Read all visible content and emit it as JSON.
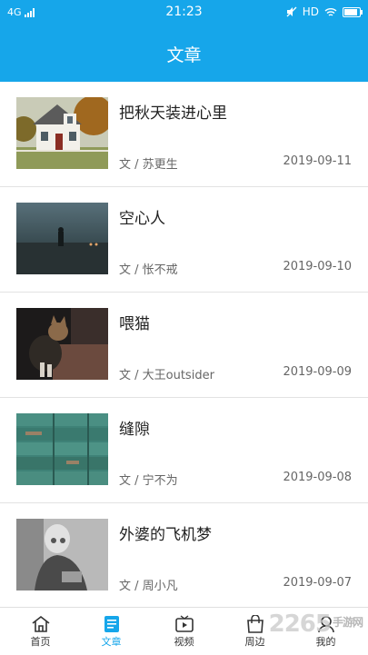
{
  "status_bar": {
    "network": "4G",
    "time": "21:23",
    "hd": "HD"
  },
  "header": {
    "title": "文章"
  },
  "articles": [
    {
      "title": "把秋天装进心里",
      "author": "文 / 苏更生",
      "date": "2019-09-11",
      "thumb": "house-photo"
    },
    {
      "title": "空心人",
      "author": "文 / 怅不戒",
      "date": "2019-09-10",
      "thumb": "dusk-field-photo"
    },
    {
      "title": "喂猫",
      "author": "文 / 大王outsider",
      "date": "2019-09-09",
      "thumb": "cat-photo"
    },
    {
      "title": "缝隙",
      "author": "文 / 宁不为",
      "date": "2019-09-08",
      "thumb": "wood-planks-photo"
    },
    {
      "title": "外婆的飞机梦",
      "author": "文 / 周小凡",
      "date": "2019-09-07",
      "thumb": "grandma-photo"
    }
  ],
  "tabs": [
    {
      "label": "首页",
      "icon": "home-icon"
    },
    {
      "label": "文章",
      "icon": "article-icon",
      "active": true
    },
    {
      "label": "视频",
      "icon": "video-icon"
    },
    {
      "label": "周边",
      "icon": "shop-bag-icon"
    },
    {
      "label": "我的",
      "icon": "user-icon"
    }
  ],
  "watermark": {
    "main": "2265",
    "sub": "手游网"
  },
  "colors": {
    "accent": "#16a6ea",
    "text": "#222222",
    "muted": "#666666"
  }
}
